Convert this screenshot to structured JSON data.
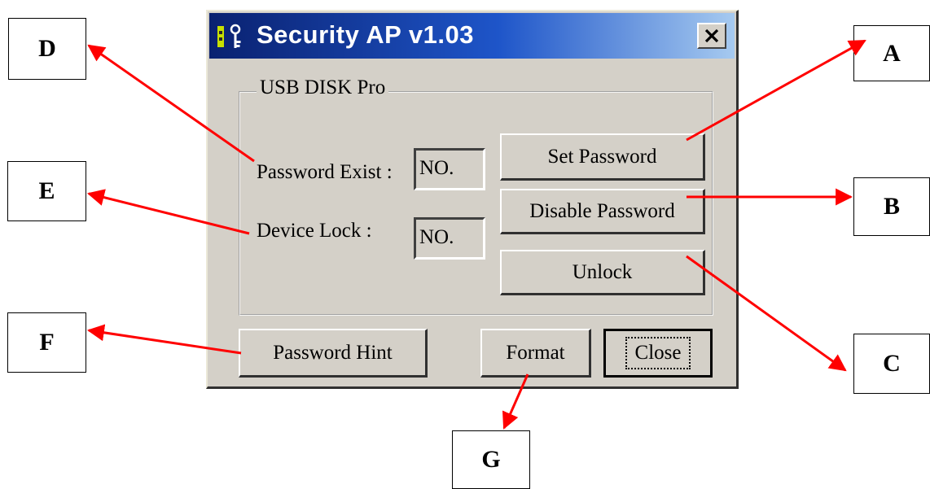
{
  "window": {
    "title": "Security AP v1.03",
    "close_symbol": "×"
  },
  "group": {
    "legend": "USB DISK Pro",
    "password_exist_label": "Password Exist :",
    "password_exist_value": "NO.",
    "device_lock_label": "Device Lock :",
    "device_lock_value": "NO."
  },
  "buttons": {
    "set_password": "Set Password",
    "disable_password": "Disable Password",
    "unlock": "Unlock",
    "password_hint": "Password Hint",
    "format": "Format",
    "close": "Close"
  },
  "callouts": {
    "a": "A",
    "b": "B",
    "c": "C",
    "d": "D",
    "e": "E",
    "f": "F",
    "g": "G"
  },
  "colors": {
    "arrow": "#ff0000",
    "dialog_face": "#d4d0c8",
    "title_gradient_start": "#0a2170",
    "title_gradient_end": "#a6caf0"
  }
}
